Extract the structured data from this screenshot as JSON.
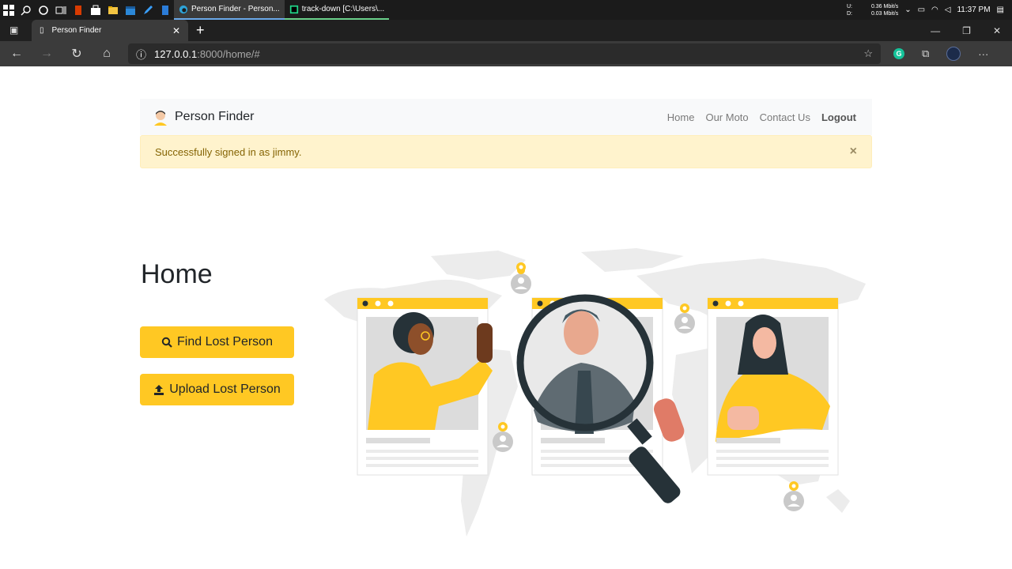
{
  "taskbar": {
    "apps": [
      {
        "label": "Person Finder - Person..."
      },
      {
        "label": "track-down [C:\\Users\\..."
      }
    ],
    "net_up_label": "U:",
    "net_up": "0.36 Mbit/s",
    "net_down_label": "D:",
    "net_down": "0.03 Mbit/s",
    "time": "11:37 PM"
  },
  "browser": {
    "tab_title": "Person Finder",
    "url_host": "127.0.0.1",
    "url_path": ":8000/home/#"
  },
  "navbar": {
    "brand": "Person Finder",
    "links": [
      "Home",
      "Our Moto",
      "Contact Us"
    ],
    "logout": "Logout"
  },
  "alert": {
    "message": "Successfully signed in as jimmy.",
    "close": "×"
  },
  "main": {
    "title": "Home",
    "find_button": "Find Lost Person",
    "upload_button": "Upload Lost Person"
  },
  "colors": {
    "accent": "#ffc823",
    "alert_bg": "#fff3cd",
    "alert_text": "#856404"
  }
}
